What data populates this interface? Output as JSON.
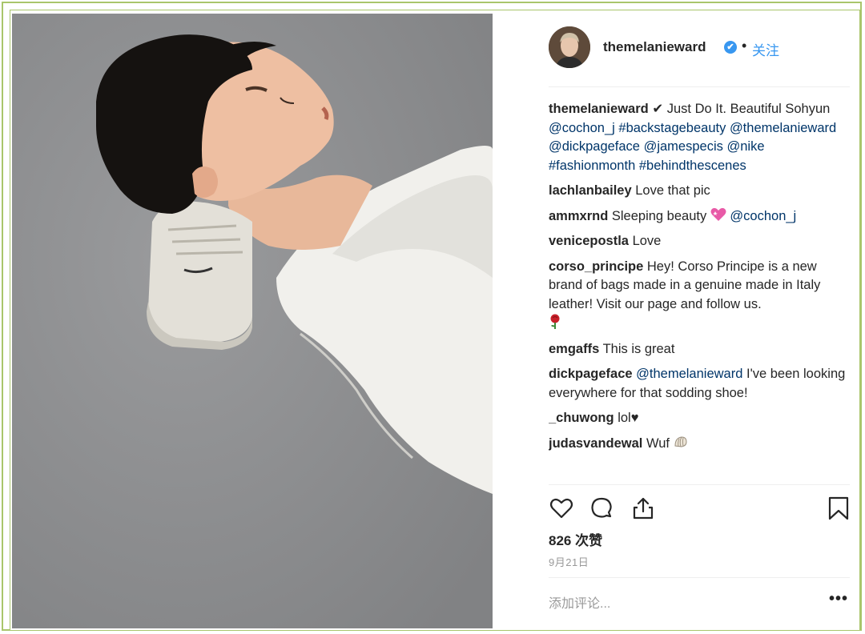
{
  "post": {
    "username": "themelanieward",
    "follow_label": "关注",
    "dot": "•",
    "verified_mark": "✔",
    "caption": {
      "username": "themelanieward",
      "check": "✔",
      "text1": " Just Do It. Beautiful Sohyun ",
      "m1": "@cochon_j",
      "h1": "#backstagebeauty",
      "m2": "@themelanieward",
      "m3": "@dickpageface",
      "m4": "@jamespecis",
      "m5": "@nike",
      "h2": "#fashionmonth",
      "h3": "#behindthescenes"
    },
    "comments": [
      {
        "username": "lachlanbailey",
        "text": "Love that pic"
      },
      {
        "username": "ammxrnd",
        "text": "Sleeping beauty",
        "mention": "@cochon_j",
        "emoji": "sparkling-heart"
      },
      {
        "username": "venicepostla",
        "text": "Love"
      },
      {
        "username": "corso_principe",
        "text": "Hey! Corso Principe is a new brand of bags made in a genuine made in Italy leather! Visit our page and follow us.",
        "emoji": "rose"
      },
      {
        "username": "emgaffs",
        "text": "This is great"
      },
      {
        "username": "dickpageface",
        "mention": "@themelanieward",
        "text": "I've been looking everywhere for that sodding shoe!"
      },
      {
        "username": "_chuwong",
        "text": "lol♥"
      },
      {
        "username": "judasvandewal",
        "text": "Wuf",
        "emoji": "shell"
      }
    ],
    "likes": "826 次赞",
    "date": "9月21日",
    "add_comment_placeholder": "添加评论...",
    "more_label": "•••"
  },
  "icons": {
    "like": "heart-icon",
    "comment": "comment-icon",
    "share": "share-icon",
    "save": "bookmark-icon"
  },
  "colors": {
    "frame": "#a9c56b",
    "link": "#003569",
    "follow": "#3897f0",
    "floor": "#8e8f91"
  }
}
